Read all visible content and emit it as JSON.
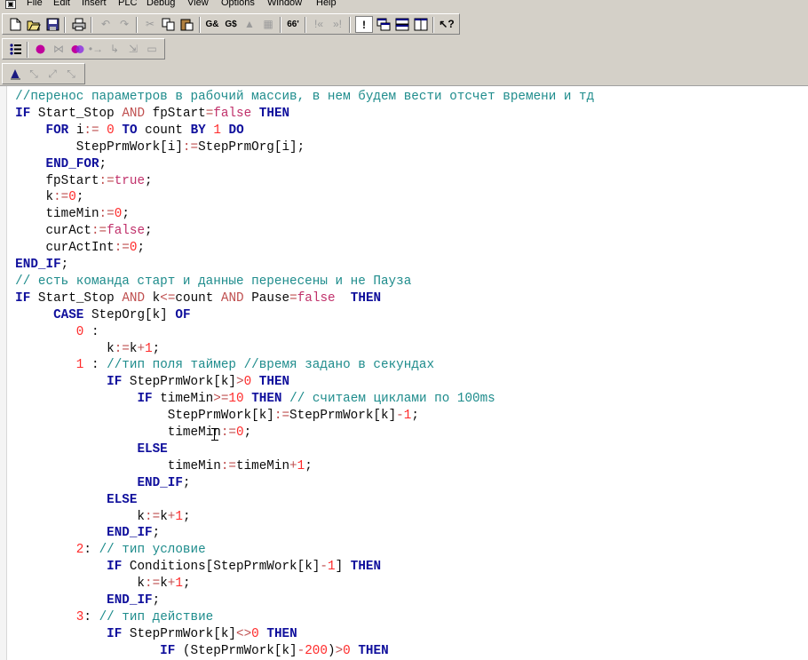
{
  "menubar": {
    "items": [
      "File",
      "Edit",
      "Insert",
      "PLC",
      "Debug",
      "View",
      "Options",
      "Window",
      "Help"
    ]
  },
  "toolbar1": {
    "buttons": [
      {
        "icon": "new-file-icon"
      },
      {
        "icon": "open-file-icon"
      },
      {
        "icon": "save-icon"
      },
      {
        "icon": "print-icon"
      },
      {
        "icon": "undo-icon"
      },
      {
        "icon": "redo-icon"
      },
      {
        "icon": "cut-icon"
      },
      {
        "icon": "copy-icon"
      },
      {
        "icon": "paste-icon"
      },
      {
        "icon": "find-icon"
      },
      {
        "icon": "find-next-icon"
      },
      {
        "icon": "replace-icon"
      },
      {
        "icon": "input-assistant-icon"
      },
      {
        "icon": "watch-icon"
      },
      {
        "icon": "step-back-icon"
      },
      {
        "icon": "step-forward-icon"
      },
      {
        "icon": "message-icon"
      },
      {
        "icon": "cascade-windows-icon"
      },
      {
        "icon": "tile-horizontal-icon"
      },
      {
        "icon": "tile-vertical-icon"
      },
      {
        "icon": "context-help-icon"
      }
    ]
  },
  "toolbar2": {
    "buttons": [
      {
        "icon": "list-icon"
      },
      {
        "icon": "breakpoint-icon"
      },
      {
        "icon": "remove-breakpoint-icon"
      },
      {
        "icon": "toggle-breakpoint-icon"
      },
      {
        "icon": "step-over-icon"
      },
      {
        "icon": "step-in-icon"
      },
      {
        "icon": "single-cycle-icon"
      },
      {
        "icon": "write-values-icon"
      }
    ]
  },
  "toolbar3": {
    "buttons": [
      {
        "icon": "login-icon"
      },
      {
        "icon": "logout-icon"
      },
      {
        "icon": "run-icon"
      },
      {
        "icon": "stop-icon"
      }
    ]
  },
  "colors": {
    "keyword": "#0f0f9c",
    "comment": "#1e8c8c",
    "number": "#ff2a2a",
    "operator": "#bf4f4f",
    "literal": "#c0306a",
    "identifier": "#0a0a0a"
  },
  "editor": {
    "lines": [
      [
        [
          "cm",
          "  //перенос параметров в рабочий массив, в нем будем вести отсчет времени и тд"
        ]
      ],
      [
        [
          "id",
          "  "
        ],
        [
          "kw",
          "IF"
        ],
        [
          "id",
          " Start_Stop "
        ],
        [
          "op",
          "AND"
        ],
        [
          "id",
          " fpStart"
        ],
        [
          "op",
          "="
        ],
        [
          "lit",
          "false"
        ],
        [
          "id",
          " "
        ],
        [
          "kw",
          "THEN"
        ]
      ],
      [
        [
          "id",
          "      "
        ],
        [
          "kw",
          "FOR"
        ],
        [
          "id",
          " i"
        ],
        [
          "op",
          ":="
        ],
        [
          "id",
          " "
        ],
        [
          "nm",
          "0"
        ],
        [
          "id",
          " "
        ],
        [
          "kw",
          "TO"
        ],
        [
          "id",
          " count "
        ],
        [
          "kw",
          "BY"
        ],
        [
          "id",
          " "
        ],
        [
          "nm",
          "1"
        ],
        [
          "id",
          " "
        ],
        [
          "kw",
          "DO"
        ]
      ],
      [
        [
          "id",
          "          StepPrmWork[i]"
        ],
        [
          "op",
          ":="
        ],
        [
          "id",
          "StepPrmOrg[i];"
        ]
      ],
      [
        [
          "id",
          "      "
        ],
        [
          "kw",
          "END_FOR"
        ],
        [
          "id",
          ";"
        ]
      ],
      [
        [
          "id",
          "      fpStart"
        ],
        [
          "op",
          ":="
        ],
        [
          "lit",
          "true"
        ],
        [
          "id",
          ";"
        ]
      ],
      [
        [
          "id",
          "      k"
        ],
        [
          "op",
          ":="
        ],
        [
          "nm",
          "0"
        ],
        [
          "id",
          ";"
        ]
      ],
      [
        [
          "id",
          "      timeMin"
        ],
        [
          "op",
          ":="
        ],
        [
          "nm",
          "0"
        ],
        [
          "id",
          ";"
        ]
      ],
      [
        [
          "id",
          "      curAct"
        ],
        [
          "op",
          ":="
        ],
        [
          "lit",
          "false"
        ],
        [
          "id",
          ";"
        ]
      ],
      [
        [
          "id",
          "      curActInt"
        ],
        [
          "op",
          ":="
        ],
        [
          "nm",
          "0"
        ],
        [
          "id",
          ";"
        ]
      ],
      [
        [
          "id",
          "  "
        ],
        [
          "kw",
          "END_IF"
        ],
        [
          "id",
          ";"
        ]
      ],
      [
        [
          "cm",
          "  // есть команда старт и данные перенесены и не Пауза"
        ]
      ],
      [
        [
          "id",
          "  "
        ],
        [
          "kw",
          "IF"
        ],
        [
          "id",
          " Start_Stop "
        ],
        [
          "op",
          "AND"
        ],
        [
          "id",
          " k"
        ],
        [
          "op",
          "<="
        ],
        [
          "id",
          "count "
        ],
        [
          "op",
          "AND"
        ],
        [
          "id",
          " Pause"
        ],
        [
          "op",
          "="
        ],
        [
          "lit",
          "false"
        ],
        [
          "id",
          "  "
        ],
        [
          "kw",
          "THEN"
        ]
      ],
      [
        [
          "id",
          "       "
        ],
        [
          "kw",
          "CASE"
        ],
        [
          "id",
          " StepOrg[k] "
        ],
        [
          "kw",
          "OF"
        ]
      ],
      [
        [
          "id",
          "          "
        ],
        [
          "nm",
          "0"
        ],
        [
          "id",
          " :"
        ]
      ],
      [
        [
          "id",
          "              k"
        ],
        [
          "op",
          ":="
        ],
        [
          "id",
          "k"
        ],
        [
          "op",
          "+"
        ],
        [
          "nm",
          "1"
        ],
        [
          "id",
          ";"
        ]
      ],
      [
        [
          "id",
          "          "
        ],
        [
          "nm",
          "1"
        ],
        [
          "id",
          " : "
        ],
        [
          "cm",
          "//тип поля таймер //время задано в секундах"
        ]
      ],
      [
        [
          "id",
          "              "
        ],
        [
          "kw",
          "IF"
        ],
        [
          "id",
          " StepPrmWork[k]"
        ],
        [
          "op",
          ">"
        ],
        [
          "nm",
          "0"
        ],
        [
          "id",
          " "
        ],
        [
          "kw",
          "THEN"
        ]
      ],
      [
        [
          "id",
          "                  "
        ],
        [
          "kw",
          "IF"
        ],
        [
          "id",
          " timeMin"
        ],
        [
          "op",
          ">="
        ],
        [
          "nm",
          "10"
        ],
        [
          "id",
          " "
        ],
        [
          "kw",
          "THEN"
        ],
        [
          "id",
          " "
        ],
        [
          "cm",
          "// считаем циклами по 100ms"
        ]
      ],
      [
        [
          "id",
          "                      StepPrmWork[k]"
        ],
        [
          "op",
          ":="
        ],
        [
          "id",
          "StepPrmWork[k]"
        ],
        [
          "op",
          "-"
        ],
        [
          "nm",
          "1"
        ],
        [
          "id",
          ";"
        ]
      ],
      [
        [
          "id",
          "                      timeMin"
        ],
        [
          "op",
          ":="
        ],
        [
          "nm",
          "0"
        ],
        [
          "id",
          ";"
        ]
      ],
      [
        [
          "id",
          "                  "
        ],
        [
          "kw",
          "ELSE"
        ]
      ],
      [
        [
          "id",
          "                      timeMin"
        ],
        [
          "op",
          ":="
        ],
        [
          "id",
          "timeMin"
        ],
        [
          "op",
          "+"
        ],
        [
          "nm",
          "1"
        ],
        [
          "id",
          ";"
        ]
      ],
      [
        [
          "id",
          "                  "
        ],
        [
          "kw",
          "END_IF"
        ],
        [
          "id",
          ";"
        ]
      ],
      [
        [
          "id",
          "              "
        ],
        [
          "kw",
          "ELSE"
        ]
      ],
      [
        [
          "id",
          "                  k"
        ],
        [
          "op",
          ":="
        ],
        [
          "id",
          "k"
        ],
        [
          "op",
          "+"
        ],
        [
          "nm",
          "1"
        ],
        [
          "id",
          ";"
        ]
      ],
      [
        [
          "id",
          "              "
        ],
        [
          "kw",
          "END_IF"
        ],
        [
          "id",
          ";"
        ]
      ],
      [
        [
          "id",
          "          "
        ],
        [
          "nm",
          "2"
        ],
        [
          "id",
          ": "
        ],
        [
          "cm",
          "// тип условие"
        ]
      ],
      [
        [
          "id",
          "              "
        ],
        [
          "kw",
          "IF"
        ],
        [
          "id",
          " Conditions[StepPrmWork[k]"
        ],
        [
          "op",
          "-"
        ],
        [
          "nm",
          "1"
        ],
        [
          "id",
          "] "
        ],
        [
          "kw",
          "THEN"
        ]
      ],
      [
        [
          "id",
          "                  k"
        ],
        [
          "op",
          ":="
        ],
        [
          "id",
          "k"
        ],
        [
          "op",
          "+"
        ],
        [
          "nm",
          "1"
        ],
        [
          "id",
          ";"
        ]
      ],
      [
        [
          "id",
          "              "
        ],
        [
          "kw",
          "END_IF"
        ],
        [
          "id",
          ";"
        ]
      ],
      [
        [
          "id",
          "          "
        ],
        [
          "nm",
          "3"
        ],
        [
          "id",
          ": "
        ],
        [
          "cm",
          "// тип действие"
        ]
      ],
      [
        [
          "id",
          "              "
        ],
        [
          "kw",
          "IF"
        ],
        [
          "id",
          " StepPrmWork[k]"
        ],
        [
          "op",
          "<>"
        ],
        [
          "nm",
          "0"
        ],
        [
          "id",
          " "
        ],
        [
          "kw",
          "THEN"
        ]
      ],
      [
        [
          "id",
          "                     "
        ],
        [
          "kw",
          "IF"
        ],
        [
          "id",
          " (StepPrmWork[k]"
        ],
        [
          "op",
          "-"
        ],
        [
          "nm",
          "200"
        ],
        [
          "id",
          ")"
        ],
        [
          "op",
          ">"
        ],
        [
          "nm",
          "0"
        ],
        [
          "id",
          " "
        ],
        [
          "kw",
          "THEN"
        ]
      ]
    ]
  }
}
